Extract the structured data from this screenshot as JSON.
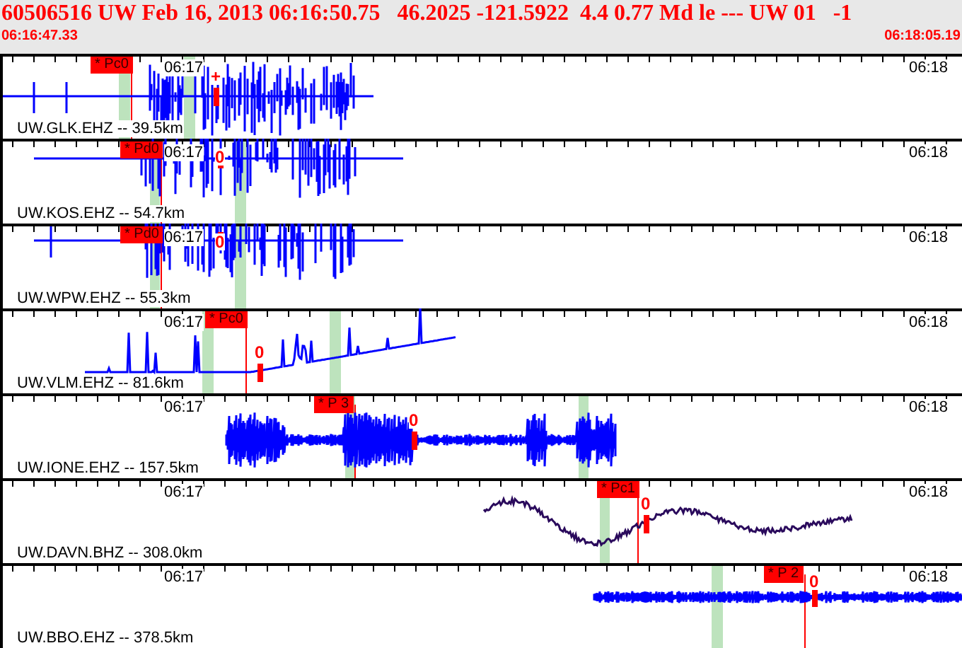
{
  "header": {
    "title": "60506516 UW Feb 16, 2013 06:16:50.75   46.2025 -121.5922  4.4 0.77 Md le --- UW 01   -1",
    "start_time": "06:16:47.33",
    "end_time": "06:18:05.19"
  },
  "traces": [
    {
      "label": "UW.GLK.EHZ -- 39.5km",
      "time_left": "06:17",
      "time_right": "06:18",
      "pick": "* Pc0",
      "polarity": "+",
      "kind": "spiky",
      "color": "#0000ff"
    },
    {
      "label": "UW.KOS.EHZ -- 54.7km",
      "time_left": "06:17",
      "time_right": "06:18",
      "pick": "* Pd0",
      "polarity": "0",
      "kind": "spiky",
      "color": "#0000ff"
    },
    {
      "label": "UW.WPW.EHZ -- 55.3km",
      "time_left": "06:17",
      "time_right": "06:18",
      "pick": "* Pd0",
      "polarity": "0",
      "kind": "spiky",
      "color": "#0000ff"
    },
    {
      "label": "UW.VLM.EHZ -- 81.6km",
      "time_left": "06:17",
      "time_right": "06:18",
      "pick": "* Pc0",
      "polarity": "0",
      "kind": "drift",
      "color": "#0000ff"
    },
    {
      "label": "UW.IONE.EHZ -- 157.5km",
      "time_left": "06:17",
      "time_right": "06:18",
      "pick": "* P 3",
      "polarity": "0",
      "kind": "noise",
      "color": "#0000ff"
    },
    {
      "label": "UW.DAVN.BHZ -- 308.0km",
      "time_left": "06:17",
      "time_right": "06:18",
      "pick": "* Pc1",
      "polarity": "0",
      "kind": "smooth",
      "color": "#2a0a5c"
    },
    {
      "label": "UW.BBO.EHZ -- 378.5km",
      "time_left": "06:17",
      "time_right": "06:18",
      "pick": "* P 2",
      "polarity": "0",
      "kind": "noise",
      "color": "#0000ff"
    }
  ]
}
